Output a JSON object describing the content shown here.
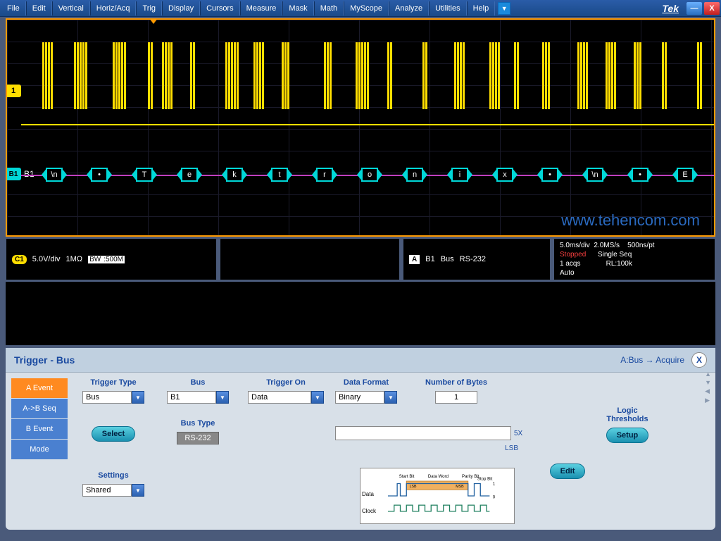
{
  "menubar": {
    "items": [
      "File",
      "Edit",
      "Vertical",
      "Horiz/Acq",
      "Trig",
      "Display",
      "Cursors",
      "Measure",
      "Mask",
      "Math",
      "MyScope",
      "Analyze",
      "Utilities",
      "Help"
    ],
    "brand": "Tek"
  },
  "scope": {
    "ch_marker": "1",
    "bus_marker": "B1",
    "bus_label": "B1",
    "bus_chars": [
      "\\n",
      "•",
      "T",
      "e",
      "k",
      "t",
      "r",
      "o",
      "n",
      "i",
      "x",
      "•",
      "\\n",
      "•",
      "E"
    ],
    "watermark": "www.tehencom.com"
  },
  "status": {
    "ch_badge": "C1",
    "vdiv": "5.0V/div",
    "impedance": "1MΩ",
    "bw_label": "BW",
    "bw_val": ":500M",
    "a_badge": "A",
    "bus_id": "B1",
    "bus_word": "Bus",
    "bus_type": "RS-232",
    "timebase": "5.0ms/div",
    "sample": "2.0MS/s",
    "resolution": "500ns/pt",
    "state": "Stopped",
    "seq": "Single Seq",
    "acqs": "1 acqs",
    "rl": "RL:100k",
    "auto": "Auto"
  },
  "trigger": {
    "title": "Trigger - Bus",
    "link": "A:Bus → Acquire",
    "tabs": {
      "a": "A Event",
      "ab": "A->B Seq",
      "b": "B Event",
      "m": "Mode"
    },
    "trigger_type_label": "Trigger Type",
    "trigger_type": "Bus",
    "select_btn": "Select",
    "settings_label": "Settings",
    "settings": "Shared",
    "bus_label": "Bus",
    "bus_val": "B1",
    "bus_type_label": "Bus Type",
    "bus_type_val": "RS-232",
    "trigger_on_label": "Trigger On",
    "trigger_on": "Data",
    "data_format_label": "Data Format",
    "data_format": "Binary",
    "num_bytes_label": "Number of Bytes",
    "num_bytes": "1",
    "mult": "5X",
    "lsb": "LSB",
    "edit_btn": "Edit",
    "logic_label": "Logic Thresholds",
    "setup_btn": "Setup",
    "diagram": {
      "data": "Data",
      "clock": "Clock",
      "start": "Start Bit",
      "word": "Data Word",
      "parity": "Parity Bit",
      "stop": "Stop Bit",
      "lsb": "LSB",
      "msb": "MSB"
    }
  }
}
